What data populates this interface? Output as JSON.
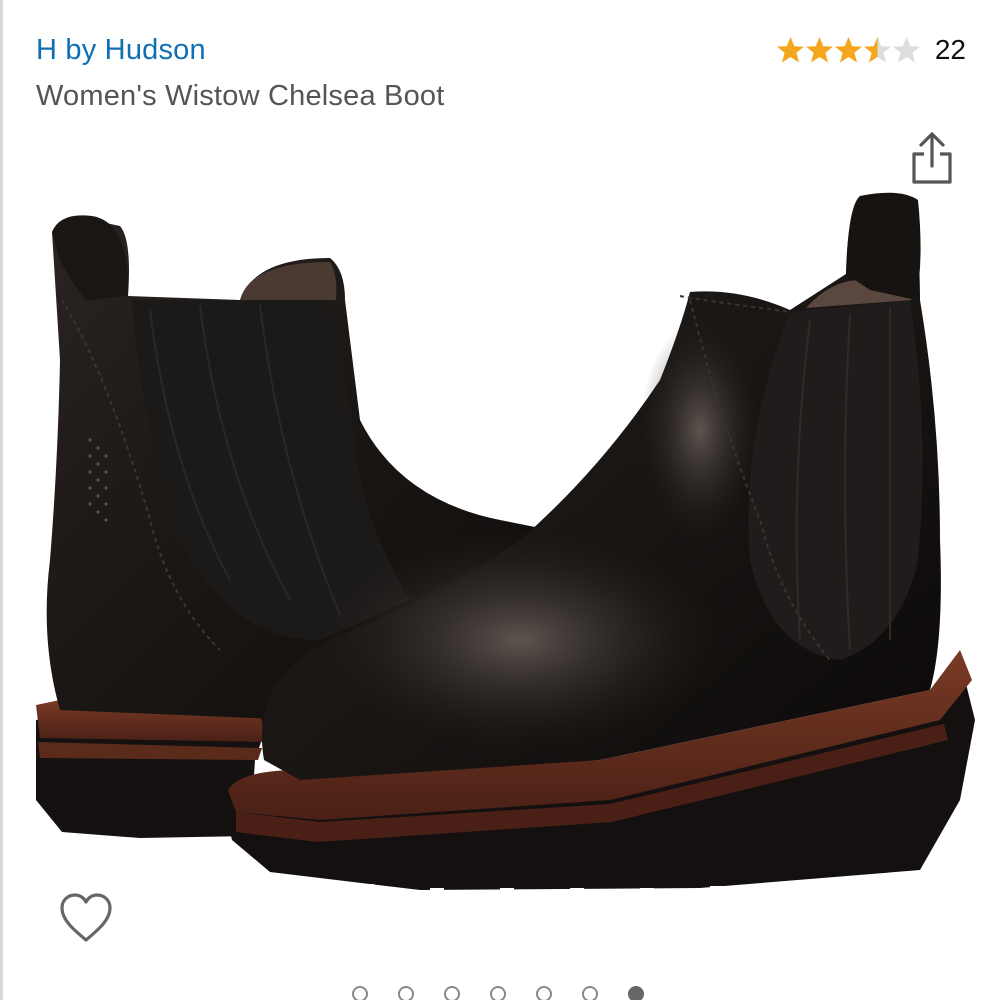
{
  "product": {
    "brand": "H by Hudson",
    "title": "Women's Wistow Chelsea Boot"
  },
  "rating": {
    "stars": 3.5,
    "max_stars": 5,
    "review_count": "22",
    "star_color": "#f4a61c",
    "empty_star_color": "#dddddd"
  },
  "icons": {
    "share": "share-icon",
    "wishlist": "heart-icon"
  },
  "carousel": {
    "image_count": 7,
    "active_index": 6
  },
  "colors": {
    "brand_link": "#0f6fb4",
    "title_text": "#555555"
  }
}
